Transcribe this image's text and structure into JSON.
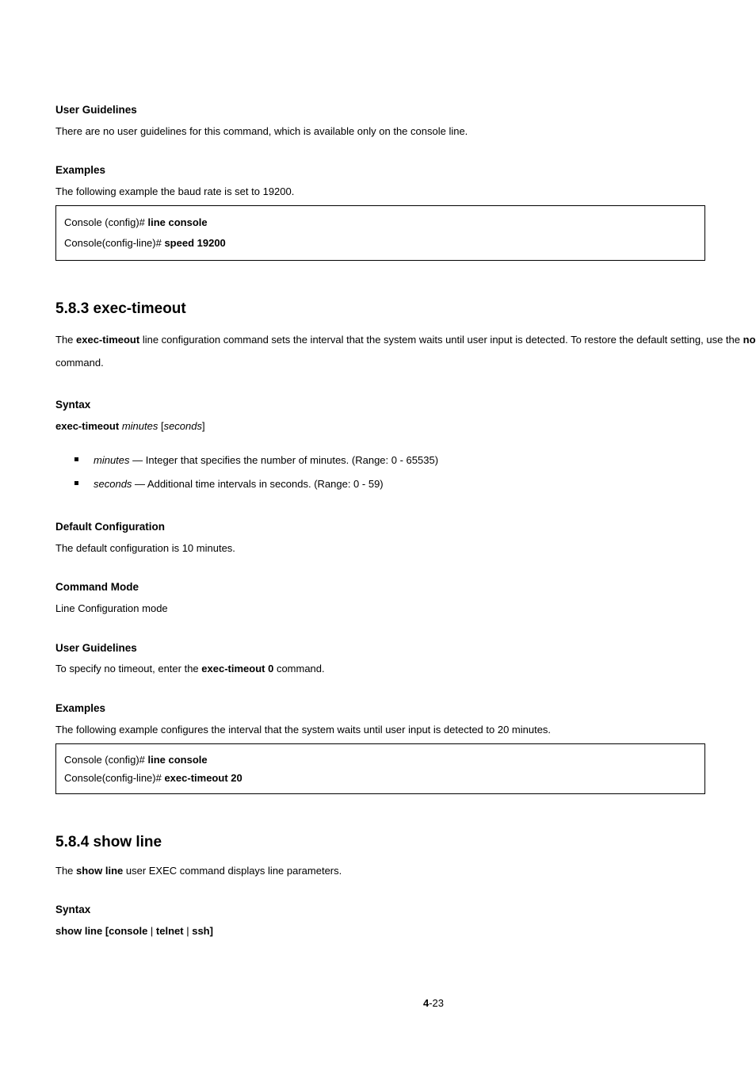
{
  "sec1": {
    "h_guidelines": "User Guidelines",
    "guidelines_text": "There are no user guidelines for this command, which is available only on the console line.",
    "h_examples": "Examples",
    "examples_lead": "The following example the baud rate is set to 19200.",
    "ex_line1_prefix": "Console (config)# ",
    "ex_line1_cmd": "line console",
    "ex_line2_prefix": "Console(config-line)# ",
    "ex_line2_cmd": "speed 19200"
  },
  "sec2": {
    "h_cmd": "5.8.3 exec-timeout",
    "intro_pre": "The ",
    "intro_cmd": "exec-timeout",
    "intro_post": " line configuration command sets the interval that the system waits until user input is detected. To restore the default setting, use the ",
    "intro_no": "no",
    "intro_tail": " form of this command.",
    "h_syntax": "Syntax",
    "syntax_main": "exec-timeout ",
    "syntax_arg1": "minutes ",
    "syntax_lb": "[",
    "syntax_arg2": "seconds",
    "syntax_rb": "]",
    "param1_name": "minutes",
    "param1_txt": " — Integer that specifies the number of minutes. (Range: 0 - 65535)",
    "param2_name": "seconds",
    "param2_txt": " — Additional time intervals in seconds. (Range: 0 - 59)",
    "h_default": "Default Configuration",
    "default_txt": "The default configuration is 10 minutes.",
    "h_mode": "Command Mode",
    "mode_txt": "Line Configuration mode",
    "h_guidelines": "User Guidelines",
    "guidelines_pre": "To specify no timeout, enter the ",
    "guidelines_cmd": "exec-timeout 0",
    "guidelines_post": " command.",
    "h_examples": "Examples",
    "examples_lead": "The following example configures the interval that the system waits until user input is detected to 20 minutes.",
    "ex_line1_prefix": "Console (config)# ",
    "ex_line1_cmd": "line console",
    "ex_line2_prefix": "Console(config-line)# ",
    "ex_line2_cmd": "exec-timeout 20"
  },
  "sec3": {
    "h_cmd": "5.8.4 show line",
    "intro_pre": "The ",
    "intro_cmd": "show line",
    "intro_post": " user EXEC command displays line parameters.",
    "h_syntax": "Syntax",
    "syntax_main": "show line [console ",
    "syntax_bar1": "| ",
    "syntax_mid": "telnet ",
    "syntax_bar2": "| ",
    "syntax_tail": "ssh]"
  },
  "pagefoot_pre": "4",
  "pagefoot_num": "-23"
}
